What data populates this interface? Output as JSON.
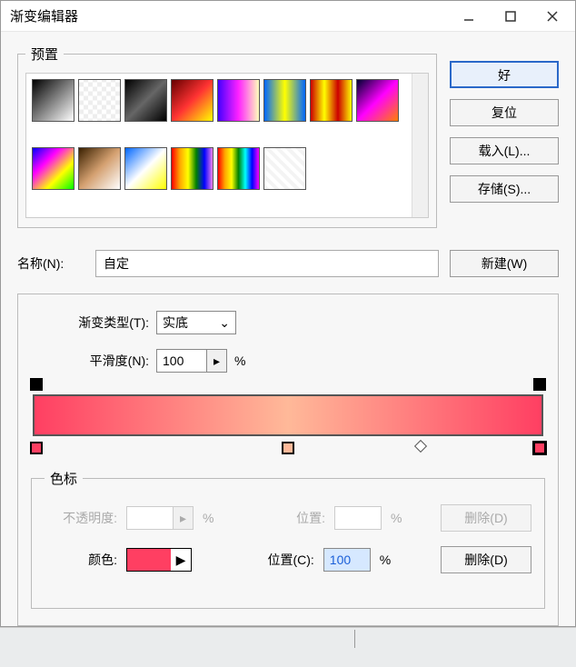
{
  "window": {
    "title": "渐变编辑器"
  },
  "presets": {
    "legend": "预置",
    "swatches": [
      {
        "bg": "linear-gradient(135deg,#000,#fff)"
      },
      {
        "bg": "repeating-conic-gradient(#eee 0 25%,#fff 0 50%) 0/10px 10px"
      },
      {
        "bg": "linear-gradient(135deg,#000,#666,#000)"
      },
      {
        "bg": "linear-gradient(135deg,#600,#f33,#ff0)"
      },
      {
        "bg": "linear-gradient(90deg,#40f,#f2f,#ffb)"
      },
      {
        "bg": "linear-gradient(90deg,#06f,#ff0,#06f)"
      },
      {
        "bg": "linear-gradient(90deg,#c00,#ff0,#c00,#ff0)"
      },
      {
        "bg": "linear-gradient(135deg,#003,#f0f,#ff8000)"
      },
      {
        "bg": "linear-gradient(135deg,#00f,#f0f,#ff0,#0f0)"
      },
      {
        "bg": "linear-gradient(135deg,#3a2000,#d4a070,#fff)"
      },
      {
        "bg": "linear-gradient(135deg,#06f,#fff,#ff0)"
      },
      {
        "bg": "linear-gradient(90deg,red,orange,yellow,green,blue,violet)"
      },
      {
        "bg": "linear-gradient(90deg,red,orange,yellow,green,cyan,blue,magenta)"
      },
      {
        "bg": "repeating-linear-gradient(45deg,#f4f4f4 0 4px,#fff 4px 8px)"
      }
    ]
  },
  "buttons": {
    "ok": "好",
    "reset": "复位",
    "load": "载入(L)...",
    "save": "存储(S)...",
    "new": "新建(W)",
    "delete_opacity": "删除(D)",
    "delete_color": "删除(D)"
  },
  "name": {
    "label": "名称(N):",
    "value": "自定"
  },
  "gradtype": {
    "label": "渐变类型(T):",
    "value": "实底"
  },
  "smooth": {
    "label": "平滑度(N):",
    "value": "100",
    "unit": "%"
  },
  "sebiao": {
    "legend": "色标",
    "opacity_label": "不透明度:",
    "opacity_unit": "%",
    "opacity_pos_label": "位置:",
    "opacity_pos_unit": "%",
    "color_label": "颜色:",
    "color_hex": "#ff3f62",
    "color_pos_label": "位置(C):",
    "color_pos_value": "100",
    "color_pos_unit": "%"
  },
  "chart_data": {
    "type": "gradient",
    "title": "自定",
    "opacity_stops": [
      {
        "position": 0,
        "opacity": 100
      },
      {
        "position": 100,
        "opacity": 100
      }
    ],
    "color_stops": [
      {
        "position": 0,
        "color": "#ff3f62"
      },
      {
        "position": 50,
        "color": "#ffb999"
      },
      {
        "position": 100,
        "color": "#ff3f62"
      }
    ],
    "midpoints": [
      75
    ],
    "selected_stop": {
      "kind": "color",
      "position": 100,
      "color": "#ff3f62"
    }
  }
}
